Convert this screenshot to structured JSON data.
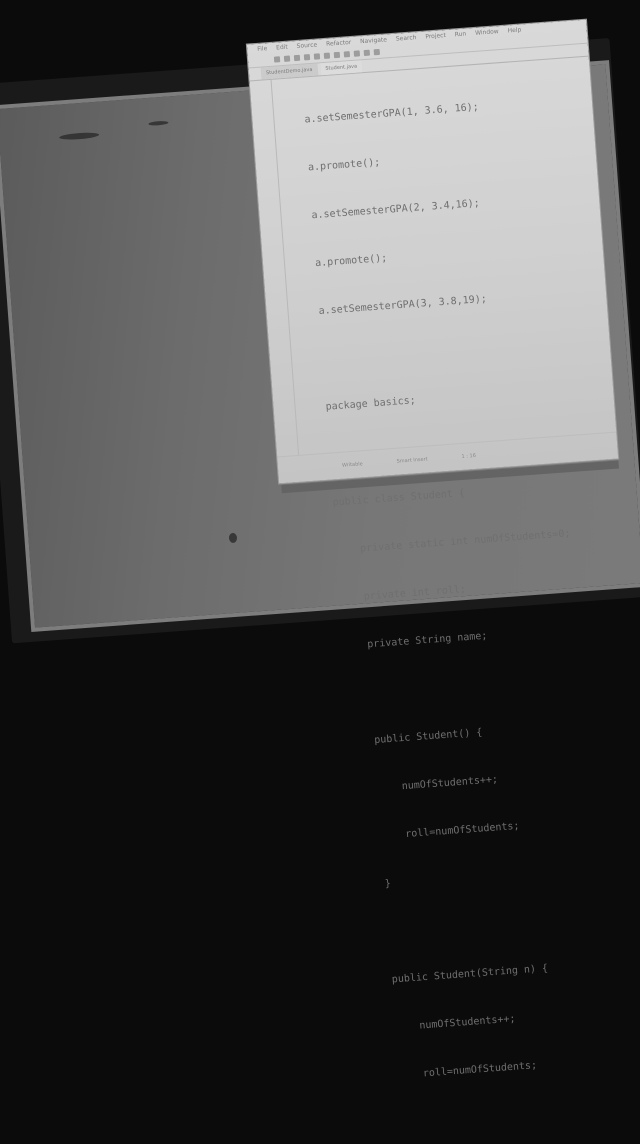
{
  "ide": {
    "menu": [
      "File",
      "Edit",
      "Source",
      "Refactor",
      "Navigate",
      "Search",
      "Project",
      "Run",
      "Window",
      "Help"
    ],
    "tabs": [
      {
        "label": "StudentDemo.java",
        "active": false
      },
      {
        "label": "Student.java",
        "active": true
      }
    ],
    "code_lines": [
      "a.setSemesterGPA(1, 3.6, 16);",
      "a.promote();",
      "a.setSemesterGPA(2, 3.4,16);",
      "a.promote();",
      "a.setSemesterGPA(3, 3.8,19);",
      "",
      "package basics;",
      "",
      "public class Student {",
      "    private static int numOfStudents=0;",
      "    private int roll;",
      "    private String name;",
      "",
      "    public Student() {",
      "        numOfStudents++;",
      "        roll=numOfStudents;",
      "    }",
      "",
      "    public Student(String n) {",
      "        numOfStudents++;",
      "        roll=numOfStudents;"
    ],
    "status": [
      "Writable",
      "Smart Insert",
      "1 : 16"
    ]
  }
}
